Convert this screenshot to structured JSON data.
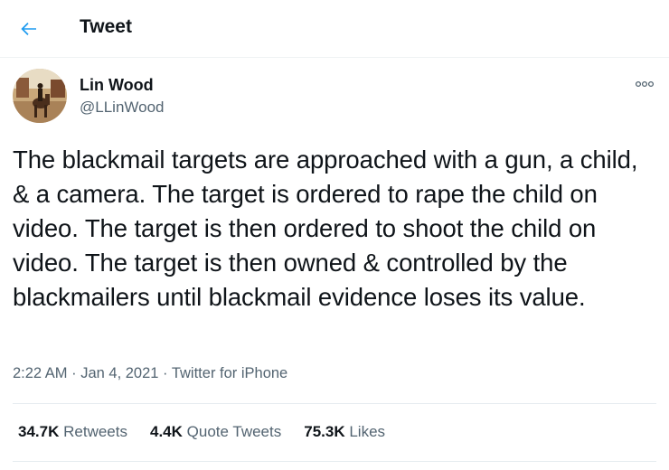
{
  "header": {
    "title": "Tweet"
  },
  "author": {
    "display_name": "Lin Wood",
    "handle": "@LLinWood"
  },
  "tweet": {
    "text": "The blackmail targets are approached with a gun, a child, & a camera. The target is ordered to rape the child on video. The target is then ordered to shoot the child on video. The target is then owned & controlled by the blackmailers until blackmail evidence loses its value."
  },
  "meta": {
    "time": "2:22 AM",
    "sep1": " · ",
    "date": "Jan 4, 2021",
    "sep2": " · ",
    "source": "Twitter for iPhone"
  },
  "stats": {
    "retweets_count": "34.7K",
    "retweets_label": "Retweets",
    "quotes_count": "4.4K",
    "quotes_label": "Quote Tweets",
    "likes_count": "75.3K",
    "likes_label": "Likes"
  },
  "colors": {
    "accent": "#1d9bf0",
    "text": "#0f1419",
    "muted": "#536471",
    "border": "#eff3f4"
  },
  "icons": {
    "back": "arrow-left-icon",
    "more": "more-horizontal-icon"
  }
}
